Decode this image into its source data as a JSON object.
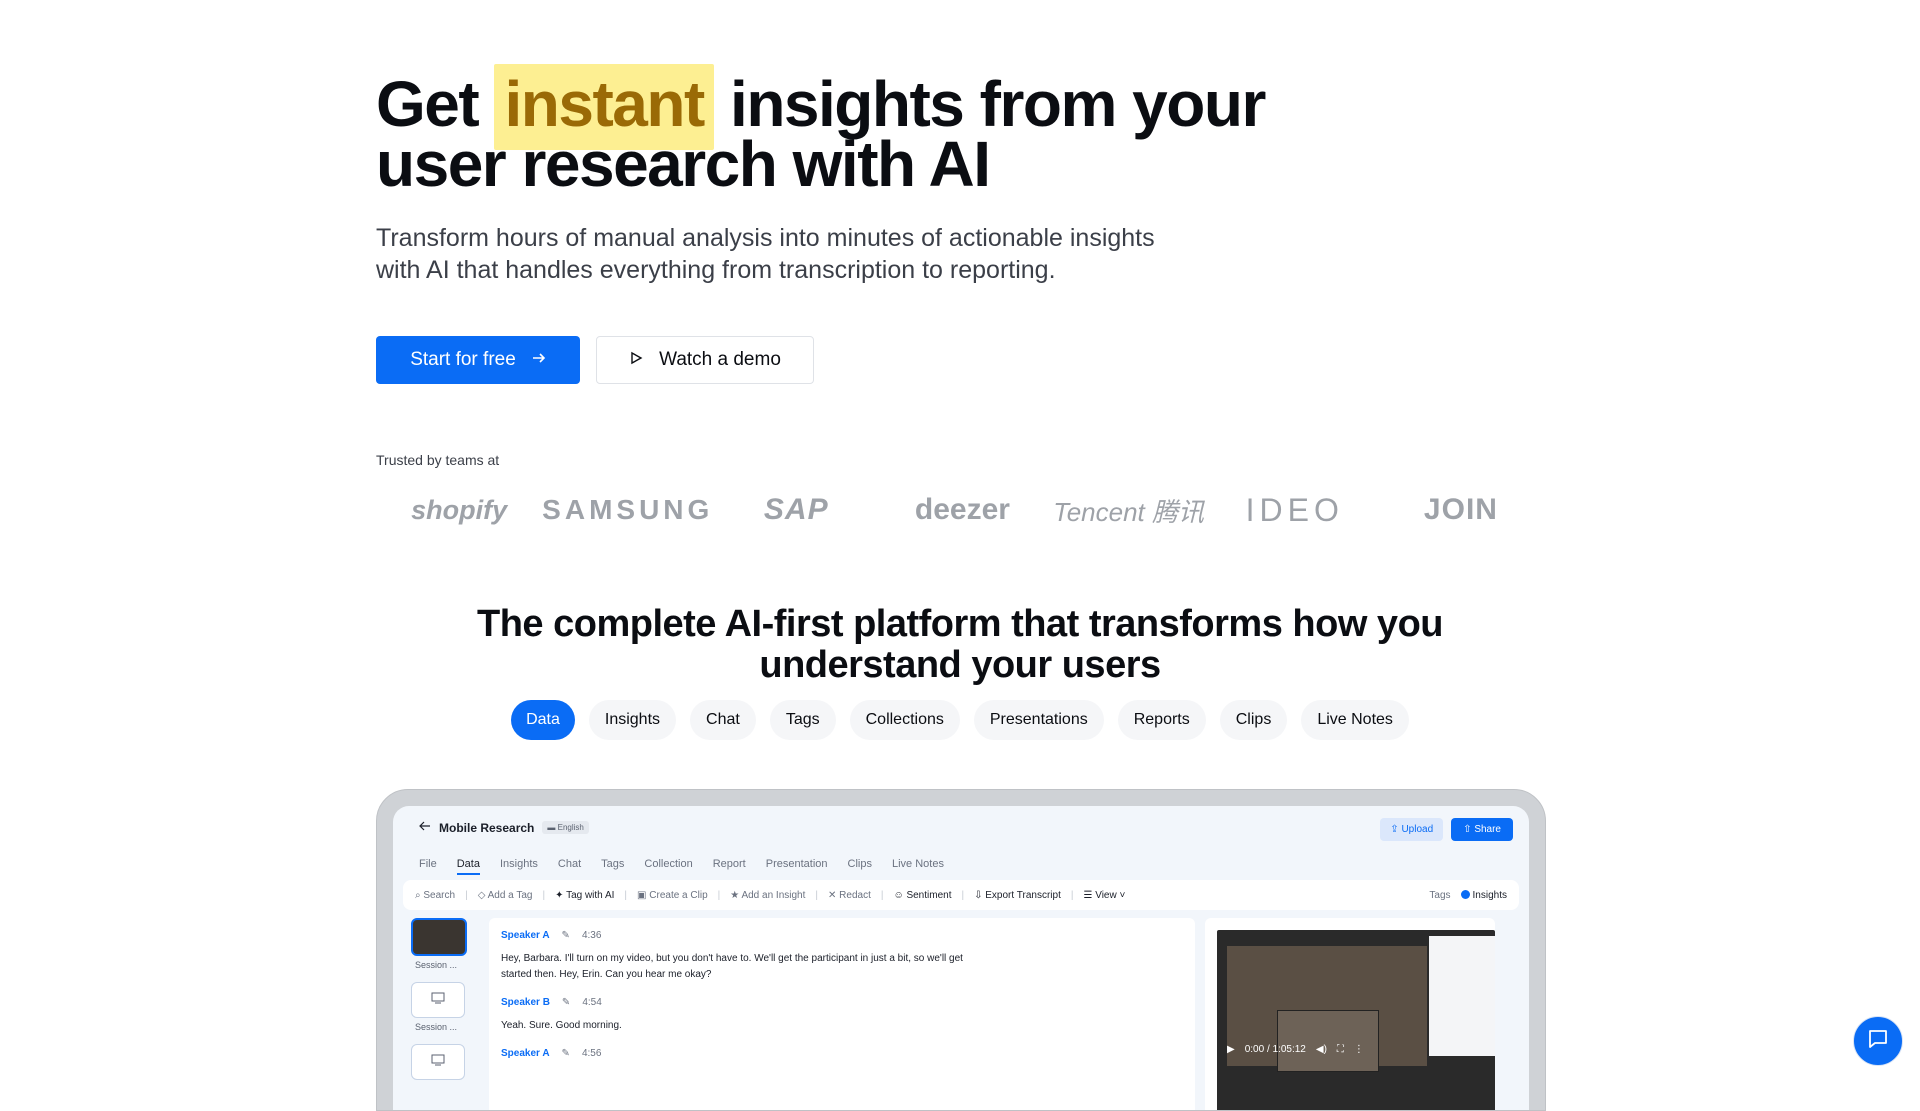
{
  "hero": {
    "title_before": "Get ",
    "title_highlight": "instant",
    "title_after": " insights from your user research with AI",
    "subtitle": "Transform hours of manual analysis into minutes of actionable insights with AI that handles everything from transcription to reporting."
  },
  "cta": {
    "primary_label": "Start for free",
    "primary_icon": "arrow-right-icon",
    "secondary_label": "Watch a demo",
    "secondary_icon": "play-icon"
  },
  "trusted": {
    "label": "Trusted by teams at",
    "logos": [
      "shopify",
      "SAMSUNG",
      "SAP",
      "deezer",
      "Tencent 腾讯",
      "IDEO",
      "JOIN"
    ]
  },
  "platform": {
    "title": "The complete AI-first platform that transforms how you understand your users",
    "tabs": [
      "Data",
      "Insights",
      "Chat",
      "Tags",
      "Collections",
      "Presentations",
      "Reports",
      "Clips",
      "Live Notes"
    ],
    "active_tab": "Data"
  },
  "app": {
    "project_title": "Mobile Research",
    "language": "English",
    "upload_label": "Upload",
    "share_label": "Share",
    "nav": [
      "File",
      "Data",
      "Insights",
      "Chat",
      "Tags",
      "Collection",
      "Report",
      "Presentation",
      "Clips",
      "Live Notes"
    ],
    "active_nav": "Data",
    "toolbar": [
      "Search",
      "Add a Tag",
      "Tag with AI",
      "Create a Clip",
      "Add an Insight",
      "Redact",
      "Sentiment",
      "Export Transcript",
      "View"
    ],
    "toolbar_right": [
      "Tags",
      "Insights"
    ],
    "sessions": [
      "Session ...",
      "Session ..."
    ],
    "transcript": [
      {
        "speaker": "Speaker A",
        "time": "4:36",
        "text": "Hey, Barbara. I'll turn on my video, but you don't have to. We'll get the participant in just a bit, so we'll get started then. Hey, Erin. Can you hear me okay?"
      },
      {
        "speaker": "Speaker B",
        "time": "4:54",
        "text": "Yeah. Sure. Good morning."
      },
      {
        "speaker": "Speaker A",
        "time": "4:56",
        "text": ""
      }
    ],
    "video_time": "0:00 / 1:05:12"
  },
  "colors": {
    "brand": "#0a6cf5",
    "highlight_bg": "#fdef92",
    "highlight_text": "#9a6a06"
  }
}
